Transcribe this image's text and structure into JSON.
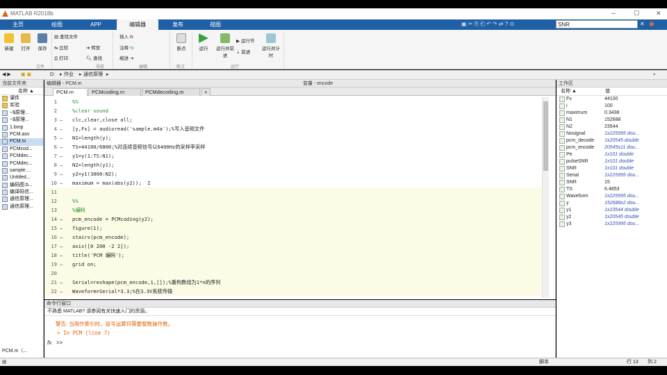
{
  "window": {
    "title": "MATLAB R2018b"
  },
  "ribbon_tabs": [
    "主页",
    "绘图",
    "APP",
    "编辑器",
    "发布",
    "视图"
  ],
  "search": {
    "value": "SNR"
  },
  "ribbon": {
    "buttons": [
      {
        "label": "新建",
        "icon": "new-icon"
      },
      {
        "label": "打开",
        "icon": "open-icon"
      },
      {
        "label": "保存",
        "icon": "save-icon"
      },
      {
        "label": "查找文件",
        "icon": "find-file-icon"
      },
      {
        "label": "比较",
        "icon": "compare-icon"
      },
      {
        "label": "打印",
        "icon": "print-icon"
      },
      {
        "label": "转至",
        "icon": "goto-icon"
      },
      {
        "label": "查找",
        "icon": "find-icon"
      },
      {
        "label": "插入",
        "icon": "insert-icon"
      },
      {
        "label": "注释",
        "icon": "comment-icon"
      },
      {
        "label": "缩进",
        "icon": "indent-icon"
      },
      {
        "label": "断点",
        "icon": "breakpoint-icon"
      },
      {
        "label": "运行",
        "icon": "run-icon"
      },
      {
        "label": "运行并前进",
        "icon": "run-advance-icon"
      },
      {
        "label": "运行节",
        "icon": "run-section-icon"
      },
      {
        "label": "前进",
        "icon": "advance-icon"
      },
      {
        "label": "运行并计时",
        "icon": "run-time-icon"
      }
    ],
    "groups": [
      "文件",
      "导航",
      "编辑",
      "断点",
      "运行"
    ]
  },
  "address": {
    "path": [
      "D:",
      "作业",
      "通信原理"
    ]
  },
  "current_folder": {
    "title": "当前文件夹",
    "col": "名称 ▲",
    "items": [
      "课件",
      "实验",
      "~$原理...",
      "~$原理...",
      "1.bmp",
      "PCM.asv",
      "PCM.m",
      "PCMcod...",
      "PCMdec...",
      "PCMdec...",
      "sample....",
      "Untitled...",
      "编码图.b...",
      "编译码信...",
      "通信原理...",
      "通信原理..."
    ],
    "selected": 6,
    "footer": "PCM.m（..."
  },
  "editor": {
    "title": "编辑器 - PCM.m",
    "var_title": "变量 - encode",
    "tabs": [
      "PCM.m",
      "PCMcoding.m",
      "PCMdecoding.m",
      "+"
    ],
    "lines": [
      {
        "n": "1",
        "d": "",
        "t": "%%",
        "k": "cm",
        "cell": false
      },
      {
        "n": "2",
        "d": "",
        "t": "%clear sound",
        "k": "cm",
        "cell": false
      },
      {
        "n": "3",
        "d": "—",
        "t": "clc,clear,close all;",
        "k": "",
        "cell": false
      },
      {
        "n": "4",
        "d": "—",
        "t": "[y,Fs] = audioread('sample.m4a');%写入音频文件",
        "k": "",
        "cell": false
      },
      {
        "n": "5",
        "d": "—",
        "t": "N1=length(y);",
        "k": "",
        "cell": false
      },
      {
        "n": "6",
        "d": "—",
        "t": "TS=44100/6800;%对连续音频信号以6400Hz的采样率采样",
        "k": "",
        "cell": false
      },
      {
        "n": "7",
        "d": "—",
        "t": "y1=y(1:TS:N1);",
        "k": "",
        "cell": false
      },
      {
        "n": "8",
        "d": "—",
        "t": "N2=length(y1);",
        "k": "",
        "cell": false
      },
      {
        "n": "9",
        "d": "—",
        "t": "y2=y1(3000:N2);",
        "k": "",
        "cell": false
      },
      {
        "n": "10",
        "d": "—",
        "t": "maximum = max(abs(y2));  I",
        "k": "",
        "cell": false
      },
      {
        "n": "11",
        "d": "",
        "t": "",
        "k": "",
        "cell": true
      },
      {
        "n": "12",
        "d": "",
        "t": "%%",
        "k": "cm",
        "cell": true
      },
      {
        "n": "13",
        "d": "",
        "t": "%编码",
        "k": "cm",
        "cell": true
      },
      {
        "n": "14",
        "d": "—",
        "t": "pcm_encode = PCMcoding(y2);",
        "k": "",
        "cell": true
      },
      {
        "n": "15",
        "d": "—",
        "t": "figure(1);",
        "k": "",
        "cell": true
      },
      {
        "n": "16",
        "d": "—",
        "t": "stairs(pcm_encode);",
        "k": "",
        "cell": true
      },
      {
        "n": "17",
        "d": "—",
        "t": "axis([0 200 -2 2]);",
        "k": "",
        "cell": true
      },
      {
        "n": "18",
        "d": "—",
        "t": "title('PCM 编码');",
        "k": "",
        "cell": true
      },
      {
        "n": "19",
        "d": "—",
        "t": "grid on;",
        "k": "",
        "cell": true
      },
      {
        "n": "20",
        "d": "",
        "t": "",
        "k": "",
        "cell": true
      },
      {
        "n": "21",
        "d": "—",
        "t": "Serial=reshape(pcm_encode,1,[]);%重构数组为1*n的序列",
        "k": "",
        "cell": true
      },
      {
        "n": "22",
        "d": "—",
        "t": "Waveform=Serial*3.3;%在3.3V系统传输",
        "k": "",
        "cell": true
      }
    ]
  },
  "command": {
    "title": "命令行窗口",
    "info": "不熟悉 MATLAB? 请参阅有关快速入门的资源。",
    "warning": "警告: 当用作索引时，冒号运算符需要整数操作数。",
    "trace": "> In PCM (line 7)",
    "prompt": ">>"
  },
  "workspace": {
    "title": "工作区",
    "cols": [
      "名称 ▲",
      "值"
    ],
    "vars": [
      {
        "name": "Fs",
        "value": "44100",
        "it": false
      },
      {
        "name": "i",
        "value": "100",
        "it": false
      },
      {
        "name": "maximum",
        "value": "0.3438",
        "it": false
      },
      {
        "name": "N1",
        "value": "152688",
        "it": false
      },
      {
        "name": "N2",
        "value": "23544",
        "it": false
      },
      {
        "name": "Nosignal",
        "value": "1x225995 dou...",
        "it": true
      },
      {
        "name": "pcm_decode",
        "value": "1x20545 double",
        "it": true
      },
      {
        "name": "pcm_encode",
        "value": "20545x11 dou...",
        "it": true
      },
      {
        "name": "Pe",
        "value": "1x101 double",
        "it": true
      },
      {
        "name": "pulseSNR",
        "value": "1x101 double",
        "it": true
      },
      {
        "name": "SNR",
        "value": "1x101 double",
        "it": true
      },
      {
        "name": "Serial",
        "value": "1x225995 dou...",
        "it": true
      },
      {
        "name": "SNR",
        "value": "15",
        "it": false
      },
      {
        "name": "TS",
        "value": "6.4853",
        "it": false
      },
      {
        "name": "Waveform",
        "value": "1x225995 dou...",
        "it": true
      },
      {
        "name": "y",
        "value": "152688x2 dou...",
        "it": true
      },
      {
        "name": "y1",
        "value": "1x23544 double",
        "it": true
      },
      {
        "name": "y2",
        "value": "1x20545 double",
        "it": true
      },
      {
        "name": "y3",
        "value": "1x225995 dou...",
        "it": true
      }
    ]
  },
  "status": {
    "mode": "脚本",
    "line": "行 13",
    "col": "列 2"
  }
}
